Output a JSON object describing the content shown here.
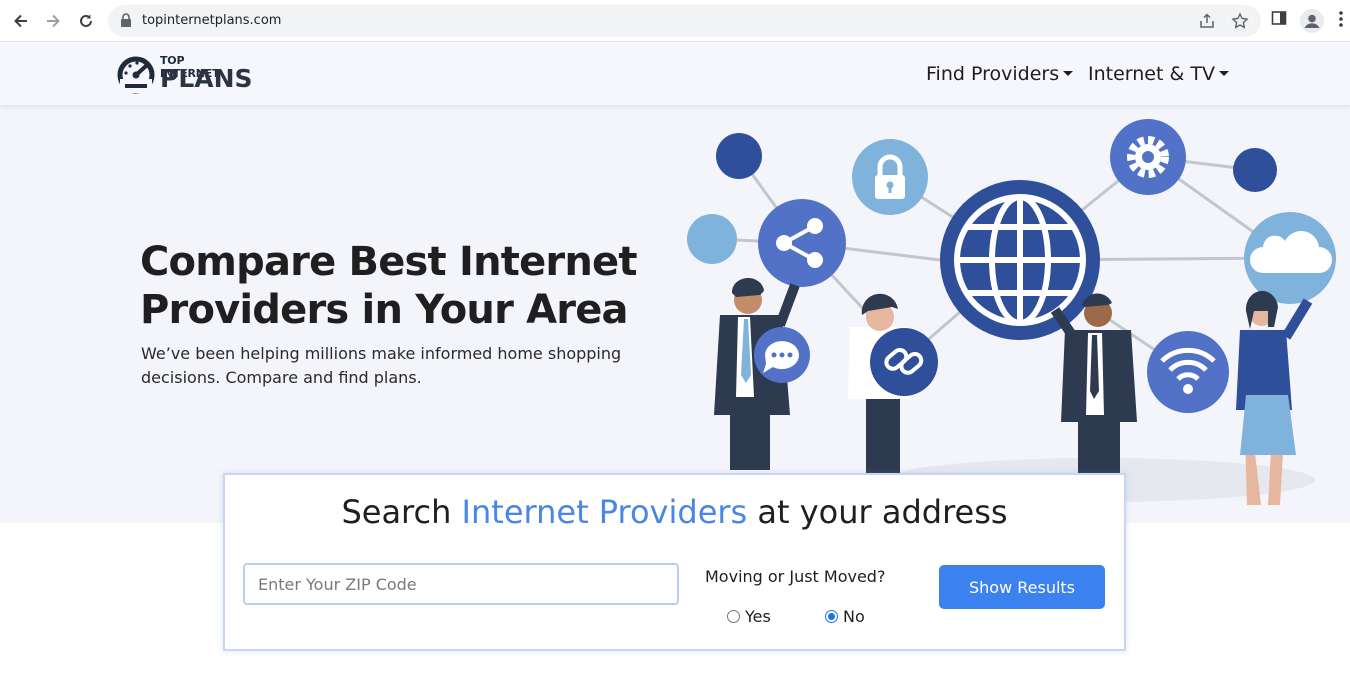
{
  "browser": {
    "url": "topinternetplans.com"
  },
  "site": {
    "logo_top": "TOP INTERNET",
    "logo_main": "PLANS",
    "menu": [
      {
        "label": "Find Providers"
      },
      {
        "label": "Internet & TV"
      }
    ]
  },
  "hero": {
    "title_line1": "Compare Best Internet",
    "title_line2": "Providers in Your Area",
    "subtitle": "We’ve been helping millions make informed home shopping decisions. Compare and find plans."
  },
  "search": {
    "heading_pre": "Search ",
    "heading_accent": "Internet Providers",
    "heading_post": " at your address",
    "zip_placeholder": "Enter Your ZIP Code",
    "zip_value": "",
    "moving_label": "Moving or Just Moved?",
    "yes_label": "Yes",
    "no_label": "No",
    "selected": "No",
    "button_label": "Show Results"
  },
  "colors": {
    "accent": "#3b82f0",
    "dark_blue": "#2f4f9a",
    "mid_blue": "#5272c7",
    "light_blue": "#7fb3dc"
  }
}
